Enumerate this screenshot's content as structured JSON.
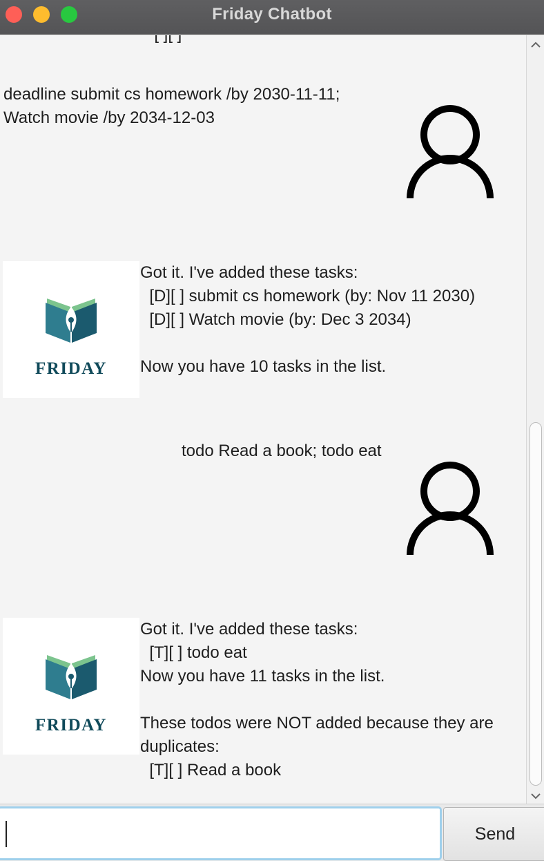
{
  "window": {
    "title": "Friday Chatbot"
  },
  "chat": {
    "cut_off_line": "  [ ][ ]",
    "messages": [
      {
        "sender": "user",
        "text": "deadline submit cs homework /by 2030-11-11;\nWatch movie /by 2034-12-03"
      },
      {
        "sender": "bot",
        "text": "Got it. I've added these tasks:\n  [D][ ] submit cs homework (by: Nov 11 2030)\n  [D][ ] Watch movie (by: Dec 3 2034)\n\nNow you have 10 tasks in the list."
      },
      {
        "sender": "user",
        "text": "todo Read a book; todo eat"
      },
      {
        "sender": "bot",
        "text": "Got it. I've added these tasks:\n  [T][ ] todo eat\nNow you have 11 tasks in the list.\n\nThese todos were NOT added because they are\nduplicates:\n  [T][ ] Read a book"
      }
    ]
  },
  "bot_avatar": {
    "brand": "FRIDAY",
    "colors": {
      "book_dark": "#1b5a6e",
      "book_light": "#2f7d8f",
      "leaf": "#7cc48e",
      "text": "#104a5a"
    }
  },
  "user_avatar": {
    "icon": "user-icon"
  },
  "input": {
    "value": "",
    "placeholder": ""
  },
  "send_button": {
    "label": "Send"
  }
}
